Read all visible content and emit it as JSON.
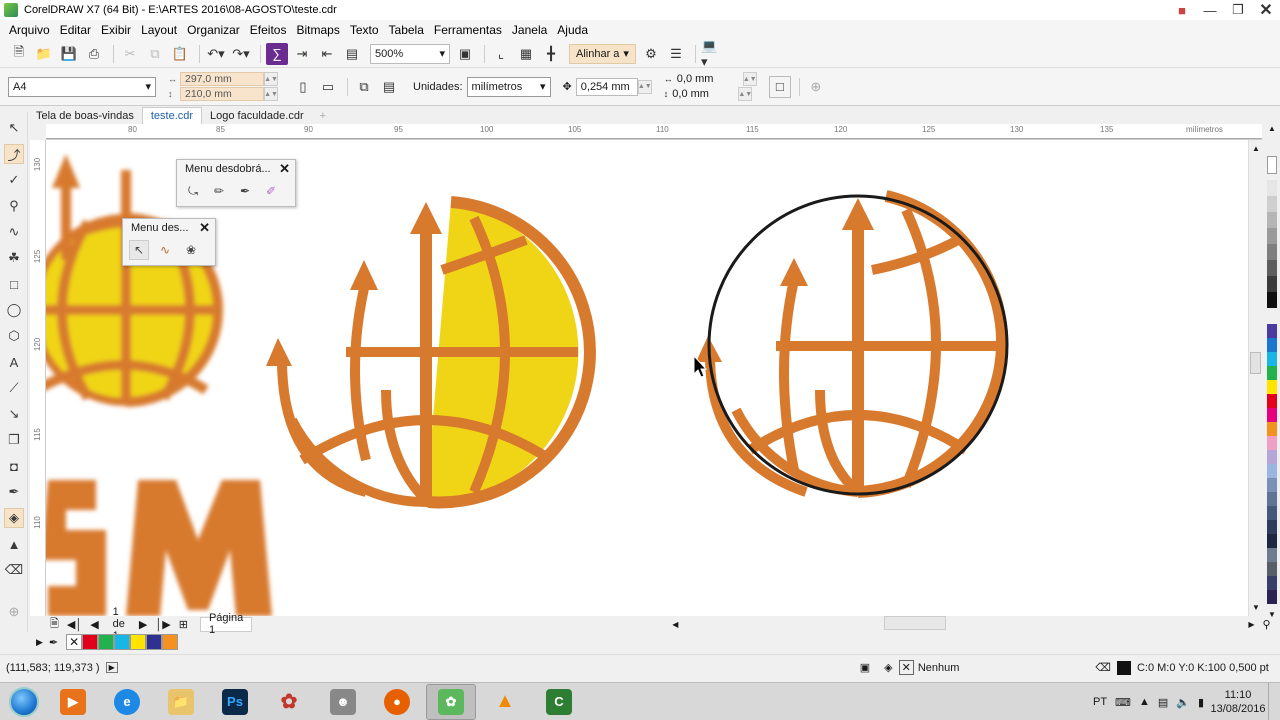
{
  "window": {
    "title": "CorelDRAW X7 (64 Bit) - E:\\ARTES 2016\\08-AGOSTO\\teste.cdr"
  },
  "menu": [
    "Arquivo",
    "Editar",
    "Exibir",
    "Layout",
    "Organizar",
    "Efeitos",
    "Bitmaps",
    "Texto",
    "Tabela",
    "Ferramentas",
    "Janela",
    "Ajuda"
  ],
  "toolbar": {
    "zoom": "500%",
    "align_label": "Alinhar a"
  },
  "propbar": {
    "page_size": "A4",
    "width": "297,0 mm",
    "height": "210,0 mm",
    "units_label": "Unidades:",
    "units": "milímetros",
    "nudge": "0,254 mm",
    "dup_x": "0,0 mm",
    "dup_y": "0,0 mm"
  },
  "tabs": [
    "Tela de boas-vindas",
    "teste.cdr",
    "Logo faculdade.cdr"
  ],
  "ruler": {
    "unit": "milímetros",
    "h_labels": [
      "80",
      "85",
      "90",
      "95",
      "100",
      "105",
      "110",
      "115",
      "120",
      "125",
      "130",
      "135"
    ],
    "v_labels": [
      "130",
      "125",
      "120",
      "115",
      "110"
    ]
  },
  "flyouts": {
    "first_title": "Menu desdobrá...",
    "second_title": "Menu des..."
  },
  "pagenav": {
    "page_count": "1 de 1",
    "page_tab": "Página 1"
  },
  "status": {
    "coords": "(111,583; 119,373 )",
    "fill": "Nenhum",
    "outline": "C:0 M:0 Y:0 K:100  0,500 pt"
  },
  "taskbar": {
    "lang": "PT",
    "time": "11:10",
    "date": "13/08/2016"
  },
  "colors": {
    "orange": "#d87a2e",
    "yellow": "#f0d516",
    "accent": "#f7e3c8"
  }
}
